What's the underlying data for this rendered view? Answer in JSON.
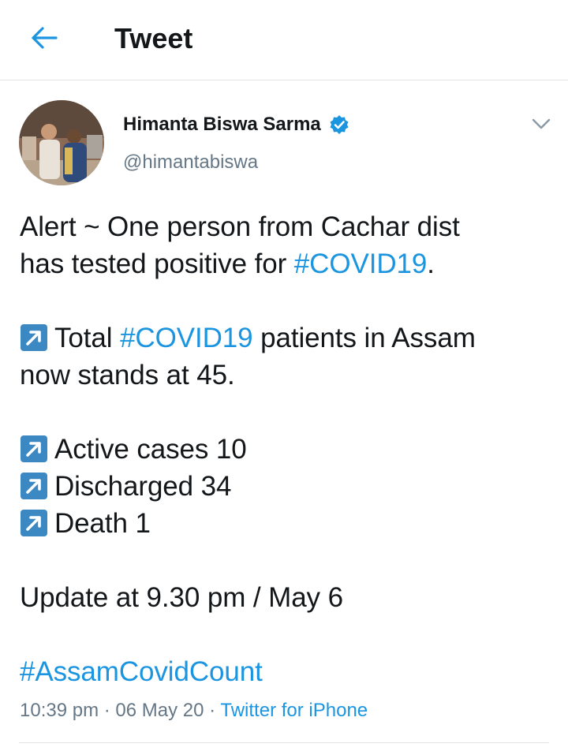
{
  "header": {
    "title": "Tweet",
    "back_icon": "arrow-left-icon"
  },
  "colors": {
    "accent": "#1b95e0",
    "text": "#14171a",
    "secondary": "#657786",
    "divider": "#dfe3e6",
    "emoji_bg": "#3b88c3"
  },
  "author": {
    "name": "Himanta Biswa Sarma",
    "handle": "@himantabiswa",
    "verified": true
  },
  "tweet": {
    "line1": "Alert ~ One person from Cachar dist",
    "line2_prefix": "has tested positive for ",
    "line2_tag": "#COVID19",
    "line2_suffix": ".",
    "line3_prefix": "Total ",
    "line3_tag": "#COVID19",
    "line3_suffix": " patients in Assam",
    "line4": "now stands at 45.",
    "stats": [
      "Active cases 10",
      "Discharged 34",
      "Death 1"
    ],
    "update": "Update at 9.30 pm / May 6",
    "hashtag": "#AssamCovidCount"
  },
  "meta": {
    "time": "10:39 pm",
    "sep1": " · ",
    "date": "06 May 20",
    "sep2": " · ",
    "source": "Twitter for iPhone"
  }
}
